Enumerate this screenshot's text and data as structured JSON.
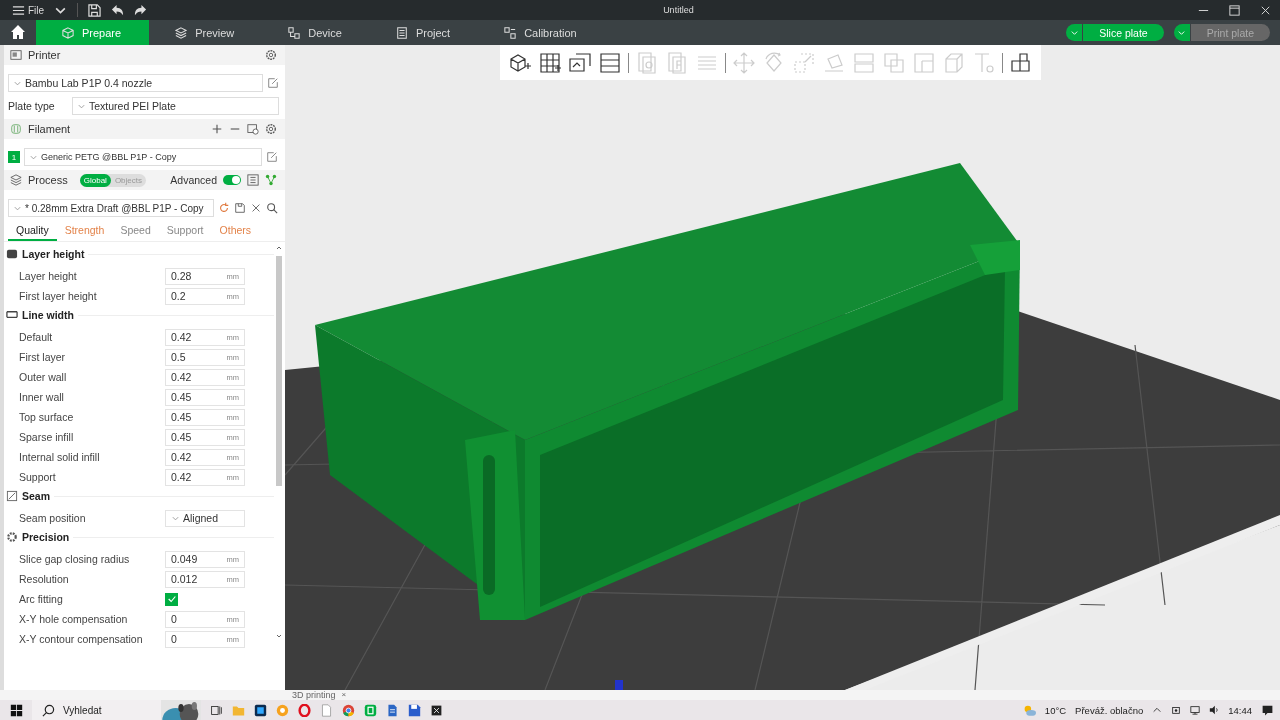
{
  "title_bar": {
    "menu": "File",
    "title": "Untitled"
  },
  "tabs": [
    {
      "label": "Prepare",
      "selected": true
    },
    {
      "label": "Preview",
      "selected": false
    },
    {
      "label": "Device",
      "selected": false
    },
    {
      "label": "Project",
      "selected": false
    },
    {
      "label": "Calibration",
      "selected": false
    }
  ],
  "actions": [
    {
      "label": "Slice plate",
      "disabled": false
    },
    {
      "label": "Print plate",
      "disabled": true
    }
  ],
  "printer": {
    "title": "Printer",
    "preset": "Bambu Lab P1P 0.4 nozzle",
    "plate_label": "Plate type",
    "plate_value": "Textured PEI Plate"
  },
  "filament": {
    "title": "Filament",
    "items": [
      {
        "index": "1",
        "name": "Generic PETG @BBL P1P - Copy",
        "color": "#00ae42"
      }
    ]
  },
  "process": {
    "title": "Process",
    "scope": [
      {
        "label": "Global",
        "selected": true
      },
      {
        "label": "Objects",
        "selected": false
      }
    ],
    "advanced_label": "Advanced",
    "advanced_on": true,
    "preset": "* 0.28mm Extra Draft @BBL P1P - Copy",
    "tabs": [
      {
        "label": "Quality",
        "selected": true,
        "modified": false
      },
      {
        "label": "Strength",
        "selected": false,
        "modified": true
      },
      {
        "label": "Speed",
        "selected": false,
        "modified": false
      },
      {
        "label": "Support",
        "selected": false,
        "modified": false
      },
      {
        "label": "Others",
        "selected": false,
        "modified": true
      }
    ]
  },
  "groups": [
    {
      "title": "Layer height",
      "rows": [
        {
          "kind": "number",
          "label": "Layer height",
          "value": "0.28",
          "unit": "mm"
        },
        {
          "kind": "number",
          "label": "First layer height",
          "value": "0.2",
          "unit": "mm"
        }
      ]
    },
    {
      "title": "Line width",
      "rows": [
        {
          "kind": "number",
          "label": "Default",
          "value": "0.42",
          "unit": "mm"
        },
        {
          "kind": "number",
          "label": "First layer",
          "value": "0.5",
          "unit": "mm"
        },
        {
          "kind": "number",
          "label": "Outer wall",
          "value": "0.42",
          "unit": "mm"
        },
        {
          "kind": "number",
          "label": "Inner wall",
          "value": "0.45",
          "unit": "mm"
        },
        {
          "kind": "number",
          "label": "Top surface",
          "value": "0.45",
          "unit": "mm"
        },
        {
          "kind": "number",
          "label": "Sparse infill",
          "value": "0.45",
          "unit": "mm"
        },
        {
          "kind": "number",
          "label": "Internal solid infill",
          "value": "0.42",
          "unit": "mm"
        },
        {
          "kind": "number",
          "label": "Support",
          "value": "0.42",
          "unit": "mm"
        }
      ]
    },
    {
      "title": "Seam",
      "rows": [
        {
          "kind": "select",
          "label": "Seam position",
          "value": "Aligned"
        }
      ]
    },
    {
      "title": "Precision",
      "rows": [
        {
          "kind": "number",
          "label": "Slice gap closing radius",
          "value": "0.049",
          "unit": "mm"
        },
        {
          "kind": "number",
          "label": "Resolution",
          "value": "0.012",
          "unit": "mm"
        },
        {
          "kind": "check",
          "label": "Arc fitting",
          "checked": true
        },
        {
          "kind": "number",
          "label": "X-Y hole compensation",
          "value": "0",
          "unit": "mm"
        },
        {
          "kind": "number",
          "label": "X-Y contour compensation",
          "value": "0",
          "unit": "mm"
        }
      ]
    }
  ],
  "toolbar": [
    [
      {
        "disabled": false
      },
      {
        "disabled": false
      },
      {
        "disabled": false
      },
      {
        "disabled": false
      }
    ],
    [
      {
        "disabled": true
      },
      {
        "disabled": true
      },
      {
        "disabled": true
      }
    ],
    [
      {
        "disabled": true
      },
      {
        "disabled": true
      },
      {
        "disabled": true
      },
      {
        "disabled": true
      },
      {
        "disabled": true
      },
      {
        "disabled": true
      },
      {
        "disabled": true
      },
      {
        "disabled": true
      },
      {
        "disabled": true
      }
    ],
    [
      {
        "disabled": false
      }
    ]
  ],
  "bottom_tab": {
    "label": "3D printing",
    "close": "×"
  },
  "taskbar": {
    "search": "Vyhledat",
    "weather": "10°C",
    "forecast": "Převáž. oblačno",
    "time": "14:44"
  }
}
